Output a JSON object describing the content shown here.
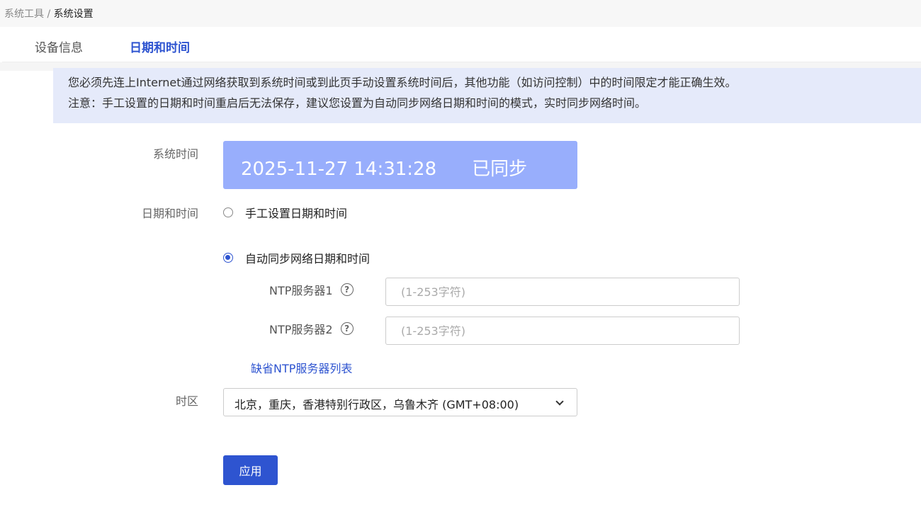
{
  "breadcrumb": {
    "parent": "系统工具",
    "separator": " / ",
    "current": "系统设置"
  },
  "tabs": [
    {
      "label": "设备信息",
      "active": false
    },
    {
      "label": "日期和时间",
      "active": true
    }
  ],
  "notice": {
    "line1": "您必须先连上Internet通过网络获取到系统时间或到此页手动设置系统时间后，其他功能（如访问控制）中的时间限定才能正确生效。",
    "line2": "注意：手工设置的日期和时间重启后无法保存，建议您设置为自动同步网络日期和时间的模式，实时同步网络时间。"
  },
  "system_time": {
    "label": "系统时间",
    "value": "2025-11-27 14:31:28",
    "status": "已同步"
  },
  "date_time": {
    "label": "日期和时间",
    "manual_label": "手工设置日期和时间",
    "auto_label": "自动同步网络日期和时间",
    "selected": "auto"
  },
  "ntp": {
    "server1_label": "NTP服务器1",
    "server2_label": "NTP服务器2",
    "placeholder": "(1-253字符)",
    "server1_value": "",
    "server2_value": "",
    "default_list_link": "缺省NTP服务器列表"
  },
  "timezone": {
    "label": "时区",
    "value": "北京，重庆，香港特别行政区，乌鲁木齐 (GMT+08:00)"
  },
  "apply_label": "应用",
  "colors": {
    "accent": "#2e54d0",
    "time_box": "#98aefc",
    "notice_bg": "#e5eafa"
  }
}
